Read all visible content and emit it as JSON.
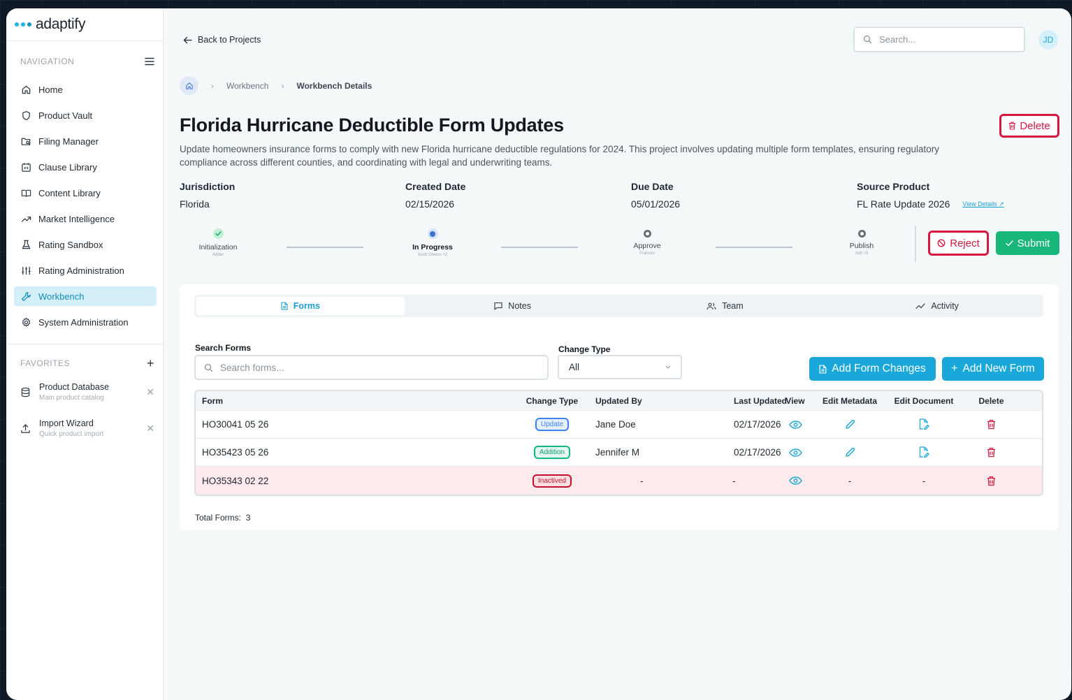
{
  "app": {
    "brand": "adaptify"
  },
  "sidebar": {
    "nav_header": "NAVIGATION",
    "items": [
      {
        "label": "Home",
        "icon": "home-icon"
      },
      {
        "label": "Product Vault",
        "icon": "shield-icon"
      },
      {
        "label": "Filing Manager",
        "icon": "folder-search-icon"
      },
      {
        "label": "Clause Library",
        "icon": "code-calendar-icon"
      },
      {
        "label": "Content Library",
        "icon": "book-open-icon"
      },
      {
        "label": "Market Intelligence",
        "icon": "trend-up-icon"
      },
      {
        "label": "Rating Sandbox",
        "icon": "flask-icon"
      },
      {
        "label": "Rating Administration",
        "icon": "sliders-icon"
      },
      {
        "label": "Workbench",
        "icon": "wrench-icon",
        "active": true
      },
      {
        "label": "System Administration",
        "icon": "gear-icon"
      }
    ],
    "fav_header": "FAVORITES",
    "favorites": [
      {
        "title": "Product Database",
        "subtitle": "Main product catalog"
      },
      {
        "title": "Import Wizard",
        "subtitle": "Quick product import"
      }
    ]
  },
  "header": {
    "back_label": "Back to Projects",
    "search_placeholder": "Search...",
    "avatar_initials": "JD"
  },
  "breadcrumb": {
    "items": [
      "Workbench",
      "Workbench Details"
    ]
  },
  "project": {
    "title": "Florida Hurricane Deductible Form Updates",
    "delete_label": "Delete",
    "description": "Update homeowners insurance forms to comply with new Florida hurricane deductible regulations for 2024. This project involves updating multiple form templates, ensuring regulatory compliance across different counties, and coordinating with legal and underwriting teams.",
    "meta": [
      {
        "label": "Jurisdiction",
        "value": "Florida"
      },
      {
        "label": "Created Date",
        "value": "02/15/2026"
      },
      {
        "label": "Due Date",
        "value": "05/01/2026"
      },
      {
        "label": "Source Product",
        "value": "FL Rate Update 2026",
        "link": "View Details ↗"
      }
    ]
  },
  "stepper": [
    {
      "label": "Initialization",
      "sub": "Adder",
      "state": "done"
    },
    {
      "label": "In Progress",
      "sub": "Scott Owens +2",
      "state": "current"
    },
    {
      "label": "Approve",
      "sub": "Frances",
      "state": "pending"
    },
    {
      "label": "Publish",
      "sub": "Anil +3",
      "state": "pending"
    }
  ],
  "actions": {
    "reject_label": "Reject",
    "submit_label": "Submit"
  },
  "tabs": [
    {
      "label": "Forms",
      "icon": "document-icon",
      "active": true
    },
    {
      "label": "Notes",
      "icon": "message-square-icon"
    },
    {
      "label": "Team",
      "icon": "users-icon"
    },
    {
      "label": "Activity",
      "icon": "activity-icon"
    }
  ],
  "forms": {
    "search_label": "Search Forms",
    "search_placeholder": "Search forms...",
    "change_type_label": "Change Type",
    "change_type_value": "All",
    "add_changes_label": "Add Form Changes",
    "add_new_label": "Add New Form",
    "columns": [
      "Form",
      "Change Type",
      "Updated By",
      "Last Updated",
      "View",
      "Edit Metadata",
      "Edit Document",
      "Delete"
    ],
    "rows": [
      {
        "form": "HO30041 05 26",
        "change_type": "Update",
        "updated_by": "Jane Doe",
        "last_updated": "02/17/2026",
        "meta": true,
        "doc": true
      },
      {
        "form": "HO35423 05 26",
        "change_type": "Addition",
        "updated_by": "Jennifer M",
        "last_updated": "02/17/2026",
        "meta": true,
        "doc": true
      },
      {
        "form": "HO35343 02 22",
        "change_type": "Inactived",
        "updated_by": "-",
        "last_updated": "-",
        "meta": false,
        "doc": false
      }
    ],
    "total_label": "Total Forms:",
    "total_value": "3"
  },
  "colors": {
    "accent": "#19a8d9",
    "danger": "#d8163e",
    "success": "#19b87a",
    "update_badge": "#3b82f6",
    "addition_badge": "#10b981",
    "inactive_badge": "#c8102e"
  }
}
